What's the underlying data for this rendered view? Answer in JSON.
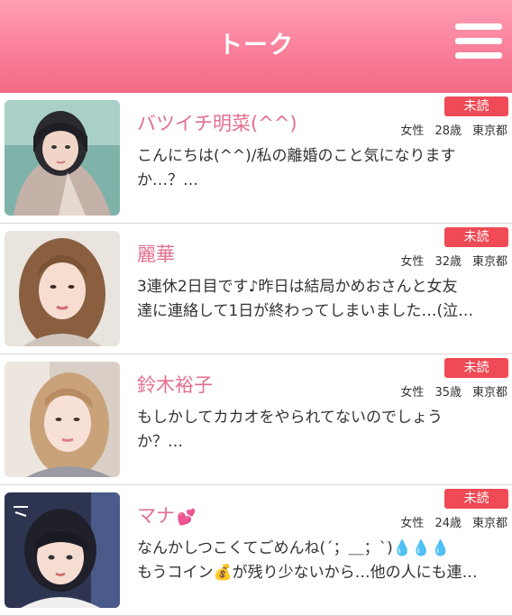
{
  "header": {
    "title": "トーク"
  },
  "badge_label": "未読",
  "conversations": [
    {
      "name": "バツイチ明菜(^^)",
      "gender": "女性",
      "age": "28歳",
      "location": "東京都",
      "message_line1": "こんにちは(^^)/私の離婚のこと気になります",
      "message_line2": "か…？…"
    },
    {
      "name": "麗華",
      "gender": "女性",
      "age": "32歳",
      "location": "東京都",
      "message_line1": "3連休2日目です♪昨日は結局かめおさんと女友",
      "message_line2": "達に連絡して1日が終わってしまいました…(泣…"
    },
    {
      "name": "鈴木裕子",
      "gender": "女性",
      "age": "35歳",
      "location": "東京都",
      "message_line1": "もしかしてカカオをやられてないのでしょう",
      "message_line2": "か？…"
    },
    {
      "name": "マナ",
      "name_emoji": "💕",
      "gender": "女性",
      "age": "24歳",
      "location": "東京都",
      "message_line1": "なんかしつこくてごめんね(´；＿；`)💧💧💧",
      "message_line2": "もうコイン💰が残り少ないから…他の人にも連…"
    }
  ]
}
